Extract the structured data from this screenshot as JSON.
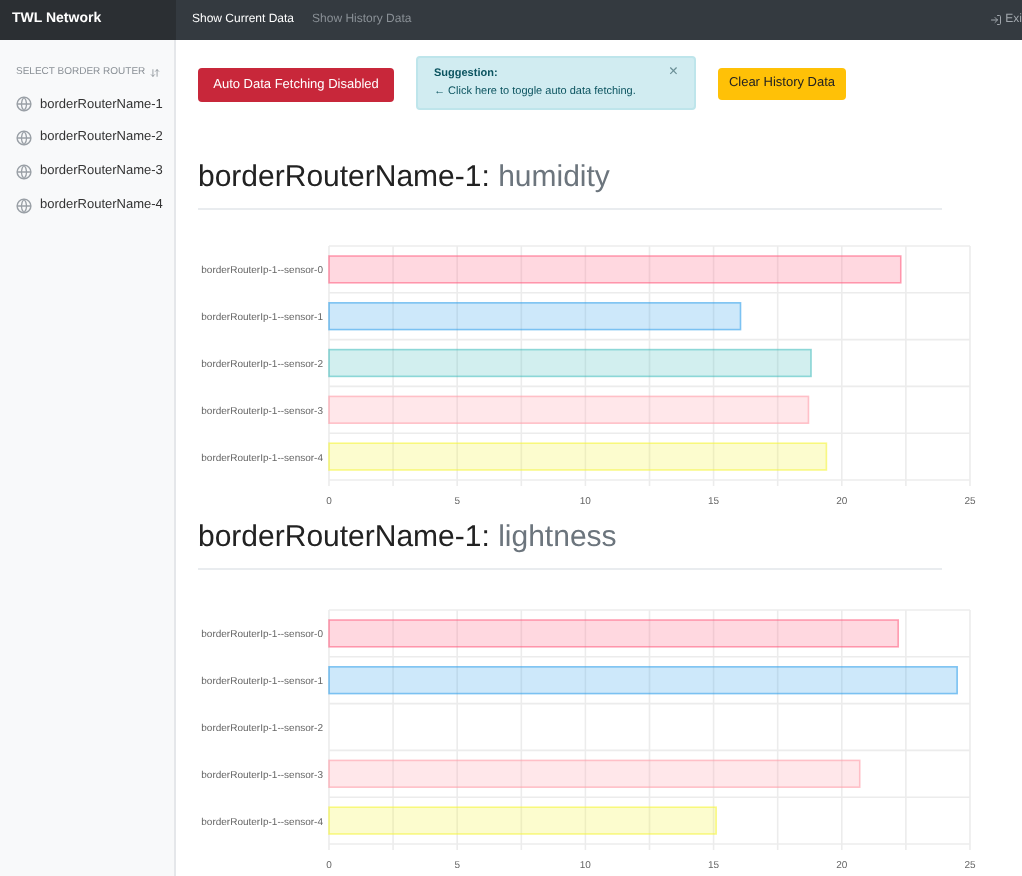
{
  "navbar": {
    "brand": "TWL Network",
    "links": [
      {
        "label": "Show Current Data",
        "selected": true
      },
      {
        "label": "Show History Data",
        "selected": false
      }
    ],
    "exit": "Exi"
  },
  "sidebar": {
    "heading": "SELECT BORDER ROUTER",
    "items": [
      "borderRouterName-1",
      "borderRouterName-2",
      "borderRouterName-3",
      "borderRouterName-4"
    ]
  },
  "toolbar": {
    "auto_fetch": {
      "label": "Auto Data Fetching Disabled",
      "on": false
    },
    "suggestion": {
      "title": "Suggestion:",
      "text": "← Click here to toggle auto data fetching.",
      "close": "×"
    },
    "clear_button": "Clear History Data"
  },
  "panels": [
    {
      "title": "borderRouterName-1:",
      "metric": "humidity",
      "chart_data": {
        "type": "bar",
        "orientation": "horizontal",
        "categories": [
          "borderRouterIp-1--sensor-0",
          "borderRouterIp-1--sensor-1",
          "borderRouterIp-1--sensor-2",
          "borderRouterIp-1--sensor-3",
          "borderRouterIp-1--sensor-4"
        ],
        "colors": [
          "#ff6384",
          "#36a2eb",
          "#4bc0c0",
          "#ff9faa",
          "#f5f53d"
        ],
        "series": [
          {
            "values": [
              22.3,
              16.05,
              18.8,
              18.7,
              19.4
            ]
          }
        ],
        "xlim": [
          0,
          25
        ],
        "xticks": [
          0,
          5,
          10,
          15,
          20,
          25
        ],
        "grid": true
      }
    },
    {
      "title": "borderRouterName-1:",
      "metric": "lightness",
      "chart_data": {
        "type": "bar",
        "orientation": "horizontal",
        "categories": [
          "borderRouterIp-1--sensor-0",
          "borderRouterIp-1--sensor-1",
          "borderRouterIp-1--sensor-2",
          "borderRouterIp-1--sensor-3",
          "borderRouterIp-1--sensor-4"
        ],
        "colors": [
          "#ff6384",
          "#36a2eb",
          null,
          "#ff9faa",
          "#f5f53d"
        ],
        "series": [
          {
            "values": [
              22.2,
              24.5,
              null,
              20.7,
              15.1
            ]
          }
        ],
        "xlim": [
          0,
          25
        ],
        "xticks": [
          0,
          5,
          10,
          15,
          20,
          25
        ],
        "grid": true
      }
    }
  ]
}
